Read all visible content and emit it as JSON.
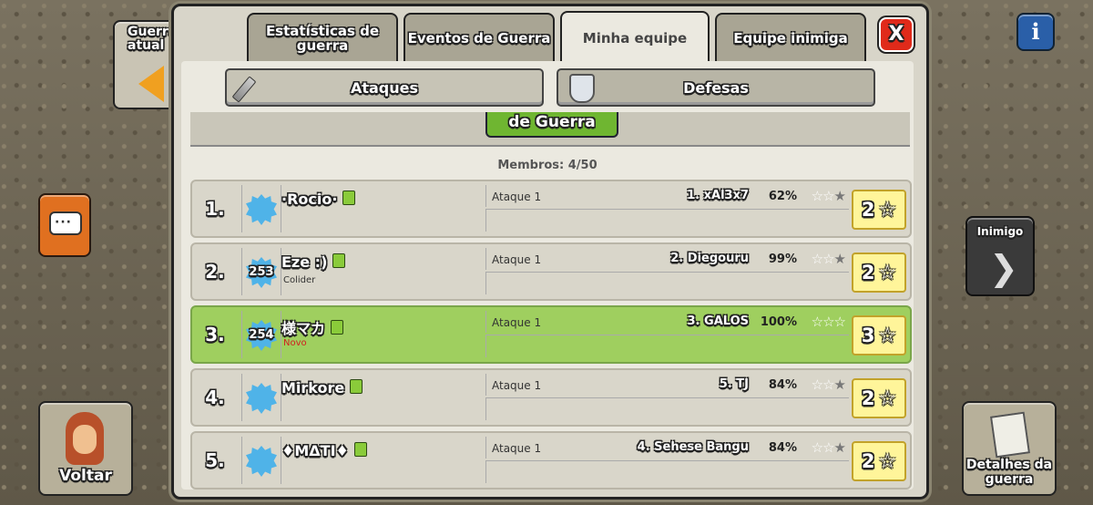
{
  "side": {
    "prev_war_label": "Guerra\natual",
    "back_label": "Voltar",
    "enemy_label": "Inimigo",
    "details_label": "Detalhes da guerra"
  },
  "tabs": [
    {
      "label": "Estatísticas de guerra",
      "active": false
    },
    {
      "label": "Eventos de Guerra",
      "active": false
    },
    {
      "label": "Minha equipe",
      "active": true
    },
    {
      "label": "Equipe inimiga",
      "active": false
    }
  ],
  "close_label": "X",
  "info_label": "i",
  "subtabs": {
    "attacks": "Ataques",
    "defenses": "Defesas"
  },
  "banner_button": "de Guerra",
  "members_text": "Membros: 4/50",
  "rows": [
    {
      "rank": "1.",
      "level": "",
      "name": "·Rocio·",
      "clan": "",
      "novo": "",
      "attack_label": "Ataque 1",
      "target": "1. xAl3x7",
      "percent": "62%",
      "stars": 2,
      "total": "2"
    },
    {
      "rank": "2.",
      "level": "253",
      "name": "Eze :)",
      "clan": "Colider",
      "novo": "",
      "attack_label": "Ataque 1",
      "target": "2. Diegouru",
      "percent": "99%",
      "stars": 2,
      "total": "2"
    },
    {
      "rank": "3.",
      "level": "254",
      "name": "様マカ",
      "clan": "",
      "novo": "Novo",
      "attack_label": "Ataque 1",
      "target": "3. GALOS",
      "percent": "100%",
      "stars": 3,
      "total": "3"
    },
    {
      "rank": "4.",
      "level": "",
      "name": "Mirkore",
      "clan": "",
      "novo": "",
      "attack_label": "Ataque 1",
      "target": "5. TJ",
      "percent": "84%",
      "stars": 2,
      "total": "2"
    },
    {
      "rank": "5.",
      "level": "",
      "name": "♦MΔTI♦",
      "clan": "",
      "novo": "",
      "attack_label": "Ataque 1",
      "target": "4. Sehese Bangu",
      "percent": "84%",
      "stars": 2,
      "total": "2"
    }
  ],
  "colors": {
    "highlight_row": "#9fcf5f",
    "badge": "#4fb3e8",
    "close": "#e02a1a",
    "accent_green": "#6fb631"
  }
}
